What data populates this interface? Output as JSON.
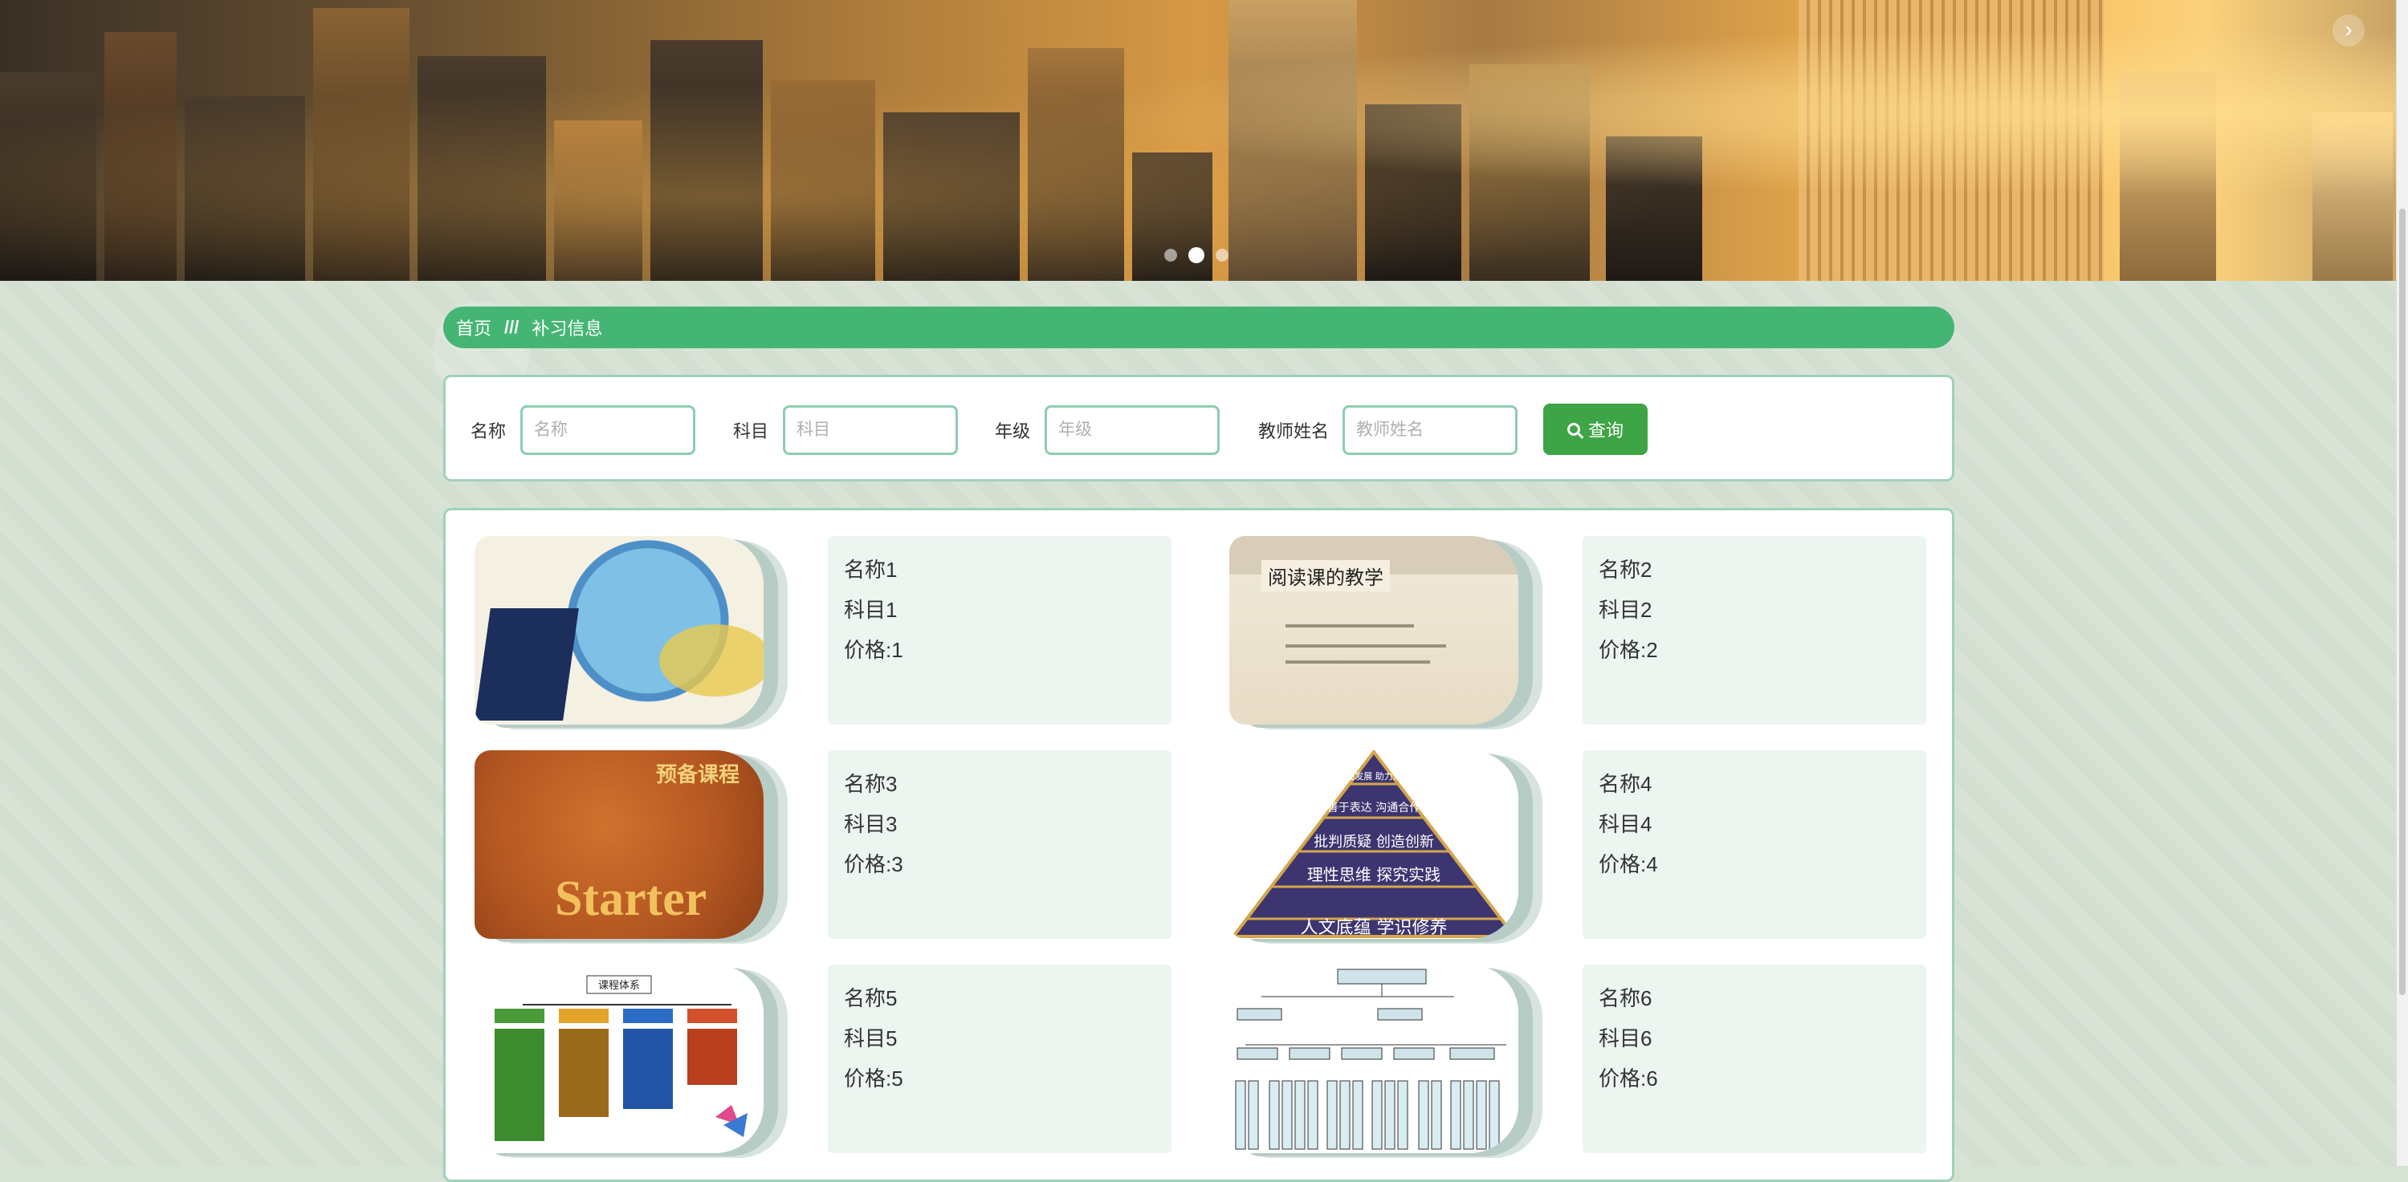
{
  "banner": {
    "carousel_dots": 3,
    "active_dot": 1,
    "next_symbol": "›"
  },
  "breadcrumb": {
    "home": "首页",
    "separator": "///",
    "current": "补习信息"
  },
  "search": {
    "fields": [
      {
        "label": "名称",
        "placeholder": "名称"
      },
      {
        "label": "科目",
        "placeholder": "科目"
      },
      {
        "label": "年级",
        "placeholder": "年级"
      },
      {
        "label": "教师姓名",
        "placeholder": "教师姓名"
      }
    ],
    "button_label": "查询"
  },
  "items": [
    {
      "name": "名称1",
      "subject": "科目1",
      "price": "价格:1"
    },
    {
      "name": "名称2",
      "subject": "科目2",
      "price": "价格:2"
    },
    {
      "name": "名称3",
      "subject": "科目3",
      "price": "价格:3"
    },
    {
      "name": "名称4",
      "subject": "科目4",
      "price": "价格:4"
    },
    {
      "name": "名称5",
      "subject": "科目5",
      "price": "价格:5"
    },
    {
      "name": "名称6",
      "subject": "科目6",
      "price": "价格:6"
    }
  ],
  "thumbnails": {
    "item2_title": "阅读课的教学",
    "item3_pre": "预备课程",
    "item3_word": "Starter",
    "item4_levels": [
      "全面发展 助力升学",
      "善于表达 沟通合作",
      "批判质疑 创造创新",
      "理性思维 探究实践",
      "人文底蕴 学识修养"
    ],
    "item5_title": "课程体系"
  },
  "colors": {
    "accent_green": "#45b574",
    "button_green": "#3da545",
    "border_green": "#9fd2b8",
    "page_bg": "#d6e2d4"
  }
}
